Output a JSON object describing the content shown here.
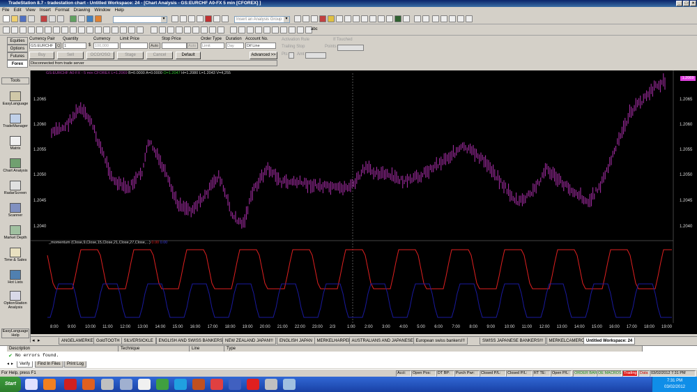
{
  "window": {
    "title": "TradeStation 8.7 - tradestation chart - Untitled Workspace: 24 - [Chart Analysis - GS:EURCHF A0-FX 5 min [CFOREX] ]"
  },
  "menu": [
    "File",
    "Edit",
    "View",
    "Insert",
    "Format",
    "Drawing",
    "Window",
    "Help"
  ],
  "toolbar": {
    "analysis_group_placeholder": "Insert an Analysis Group",
    "text_tool_label": "abc"
  },
  "order_bar": {
    "tabs": [
      "Equities",
      "Options",
      "Futures",
      "Forex"
    ],
    "labels": [
      "Currency Pair",
      "Quantity",
      "Currency",
      "Limit Price",
      "Stop Price",
      "Order Type",
      "Duration",
      "Account No."
    ],
    "fields": {
      "pair": "GS:EURCHF",
      "pair_btn": "Q",
      "quantity": "1",
      "currency_sym": "$",
      "currency": "100,000",
      "limit_auto": "Auto",
      "stop_auto": "Auto",
      "order_type": "Limit",
      "duration": "Day",
      "account": "Dif Line"
    },
    "buttons": [
      "Buy",
      "Sell",
      "OCO/OSO",
      "Stage",
      "Cancel",
      "Default",
      "Advanced >>"
    ],
    "status": "Disconnected from trade server",
    "options": {
      "activation_rule": "Activation Rule",
      "if_touched": "If Touched",
      "trailing_stop": "Trailing Stop",
      "points": "Points",
      "pts": "Pts",
      "amt": "Amt"
    }
  },
  "sidebar": {
    "title": "Tools",
    "items": [
      "EasyLanguage",
      "TradeManager",
      "Matrix",
      "Chart Analysis",
      "RadarScreen",
      "Scanner",
      "Market Depth",
      "Time & Sales",
      "Hot Lists",
      "OptionStation Analysis",
      "EasyLanguage Help"
    ]
  },
  "chart": {
    "header": {
      "symbol": "GS:EURCHF A0-FX - 5 min  CFOREX",
      "last": "L=1.2069",
      "bid": "B=0.0000",
      "ask": "A=0.0000",
      "open": "O=1.2047",
      "high": "H=1.2080",
      "low": "L=1.2043",
      "volume": "V=4,255"
    },
    "price_badge": "1.2069",
    "indicator_label": "_momentum (Close,9,Close,15,Close,21,Close,27,Close,...)",
    "indicator_val1": "0.00",
    "indicator_val2": "0.00",
    "y_labels": [
      "1.2065",
      "1.2060",
      "1.2055",
      "1.2050",
      "1.2045",
      "1.2040"
    ],
    "x_labels": [
      "8:00",
      "9:00",
      "10:00",
      "11:00",
      "12:00",
      "13:00",
      "14:00",
      "15:00",
      "16:00",
      "17:00",
      "18:00",
      "19:00",
      "20:00",
      "21:00",
      "22:00",
      "23:00",
      "2/3",
      "1:00",
      "2:00",
      "3:00",
      "4:00",
      "5:00",
      "6:00",
      "7:00",
      "8:00",
      "9:00",
      "10:00",
      "11:00",
      "12:00",
      "13:00",
      "14:00",
      "15:00",
      "16:00",
      "17:00",
      "18:00",
      "19:00"
    ],
    "colors": {
      "bars": "#b030b0",
      "momentum1": "#e02020",
      "momentum2": "#1a1aa0"
    }
  },
  "workspace_tabs": [
    "ANGELAMERKEL",
    "GoldTOOTH",
    "SILVERSICKLE",
    "ENGLISH AND SWISS BANKERS",
    "NEW ZEALAND JAPAN!!!",
    "ENGLISH JAPAN",
    "MERKELHARPER",
    "AUSTRALIANS AND JAPANESE",
    "European swiss bankers!!!",
    "SWISS JAPANESE BANKERS!!!",
    "MERKELCAMERON",
    "Untitled Workspace: 24"
  ],
  "output_pane": {
    "columns": [
      "Description",
      "Technique",
      "Line",
      "Type"
    ],
    "message": "No errors found.",
    "tabs": [
      "Verify",
      "Find In Files",
      "Print Log"
    ]
  },
  "status_bar": {
    "help": "For Help, press F1",
    "fields": [
      "Acct:",
      "Open Pos:",
      "DT BP:",
      "Purch Pwr:",
      "Closed P/L:",
      "Closed P/L:",
      "RT TE:",
      "Open P/L:"
    ],
    "indicators": [
      "ORDER BAR",
      "OE MACROS",
      "Trading",
      "Data"
    ],
    "datetime": "03/02/2012  7:31 PM"
  },
  "taskbar": {
    "start": "Start",
    "clock_time": "7:31 PM",
    "clock_date": "03/02/2012"
  }
}
